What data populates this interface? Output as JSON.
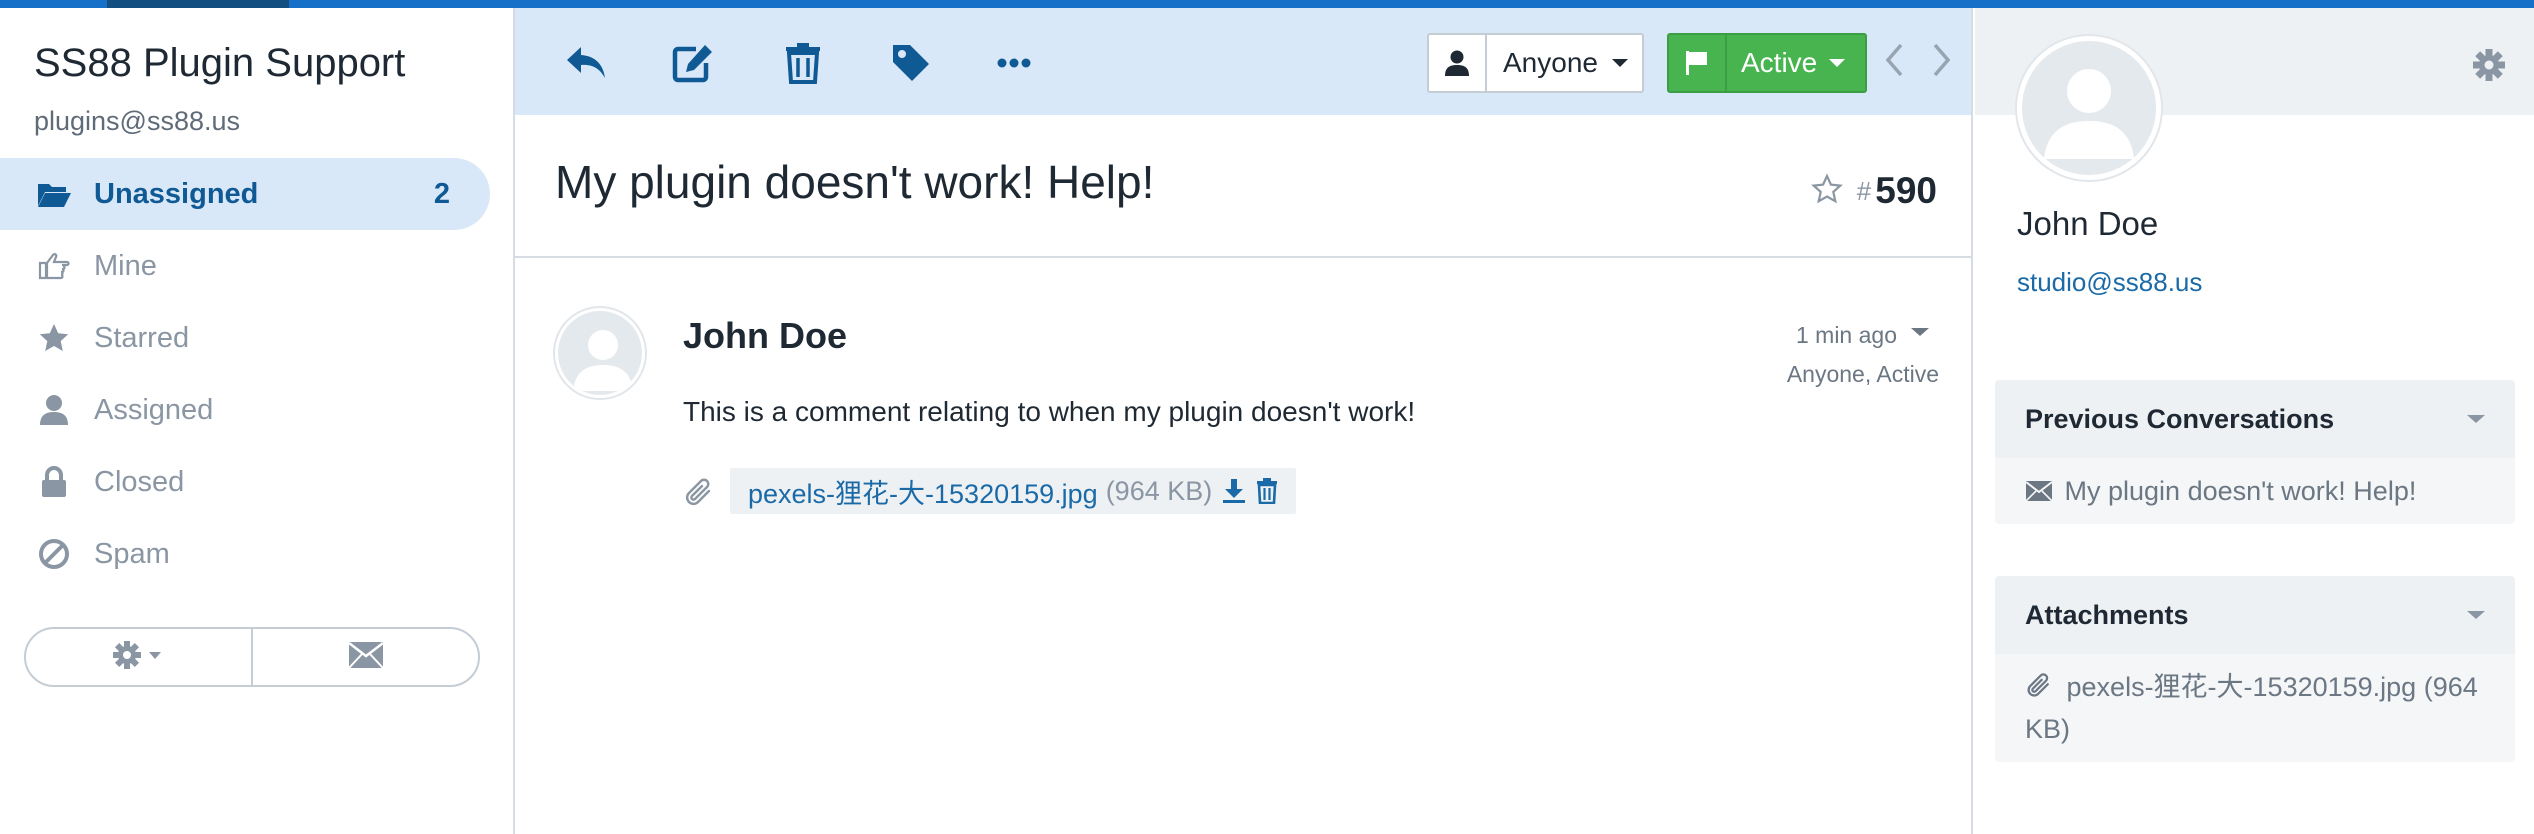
{
  "mailbox": {
    "name": "SS88 Plugin Support",
    "email": "plugins@ss88.us"
  },
  "folders": [
    {
      "label": "Unassigned",
      "count": "2",
      "icon": "folder-open-icon",
      "active": true
    },
    {
      "label": "Mine",
      "count": "",
      "icon": "hand-point-right-icon"
    },
    {
      "label": "Starred",
      "count": "",
      "icon": "star-icon"
    },
    {
      "label": "Assigned",
      "count": "",
      "icon": "user-icon"
    },
    {
      "label": "Closed",
      "count": "",
      "icon": "lock-icon"
    },
    {
      "label": "Spam",
      "count": "",
      "icon": "ban-icon"
    }
  ],
  "sidebar_actions": {
    "settings_icon": "gear-dropdown-icon",
    "compose_icon": "envelope-icon"
  },
  "toolbar": {
    "icons": [
      "reply-icon",
      "edit-icon",
      "trash-icon",
      "tag-icon",
      "more-icon"
    ],
    "assignee": "Anyone",
    "status": "Active",
    "status_color": "#47b44f"
  },
  "conversation": {
    "subject": "My plugin doesn't work! Help!",
    "hash": "#",
    "number": "590"
  },
  "thread": {
    "author": "John Doe",
    "time": "1 min ago",
    "meta": "Anyone, Active",
    "body": "This is a comment relating to when my plugin doesn't work!",
    "attachment": {
      "filename": "pexels-狸花-大-15320159.jpg",
      "size": "(964 KB)"
    }
  },
  "customer": {
    "name": "John Doe",
    "email": "studio@ss88.us"
  },
  "previous_conversations": {
    "title": "Previous Conversations",
    "items": [
      "My plugin doesn't work! Help!"
    ]
  },
  "attachments_panel": {
    "title": "Attachments",
    "items": [
      "pexels-狸花-大-15320159.jpg (964 KB)"
    ]
  },
  "colors": {
    "accent": "#1670c7",
    "active_bg": "#d9e8f8",
    "link": "#1a6aa8"
  }
}
